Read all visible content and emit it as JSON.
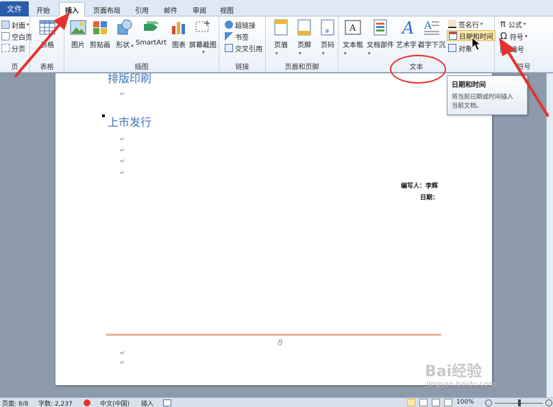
{
  "tabs": {
    "file": "文件",
    "items": [
      "开始",
      "插入",
      "页面布局",
      "引用",
      "邮件",
      "审阅",
      "视图"
    ],
    "active": "插入"
  },
  "ribbon": {
    "pages": {
      "label": "页",
      "items": [
        "封面",
        "空白页",
        "分页"
      ]
    },
    "table": {
      "label": "表格",
      "button": "表格"
    },
    "illustrations": {
      "label": "插图",
      "buttons": [
        "图片",
        "剪贴画",
        "形状",
        "SmartArt",
        "图表",
        "屏幕截图"
      ]
    },
    "links": {
      "label": "链接",
      "items": [
        "超链接",
        "书签",
        "交叉引用"
      ]
    },
    "header_footer": {
      "label": "页眉和页脚",
      "buttons": [
        "页眉",
        "页脚",
        "页码"
      ]
    },
    "text": {
      "label": "文本",
      "buttons": [
        "文本框",
        "文档部件",
        "艺术字",
        "首字下沉"
      ],
      "small": [
        "签名行",
        "日期和时间",
        "对象"
      ]
    },
    "symbols": {
      "label": "符号",
      "items": [
        "公式",
        "符号",
        "编号"
      ]
    }
  },
  "tooltip": {
    "title": "日期和时间",
    "desc1": "将当前日期或时间插入",
    "desc2": "当前文档。"
  },
  "document": {
    "heading_partial": "排版印刷",
    "heading": "上市发行",
    "author": "编写人：李辉",
    "date": "日期：",
    "page_number": "8",
    "para_mark": "↵"
  },
  "status": {
    "page": "页面: 8/8",
    "words": "字数: 2,237",
    "lang": "中文(中国)",
    "mode": "插入",
    "zoom": "100%"
  },
  "watermark": {
    "brand": "Bai经验",
    "url": "jingyan.baidu.com"
  },
  "colors": {
    "accent": "#2a5ca8",
    "annotation": "#e5322d",
    "heading": "#3f73b8"
  }
}
